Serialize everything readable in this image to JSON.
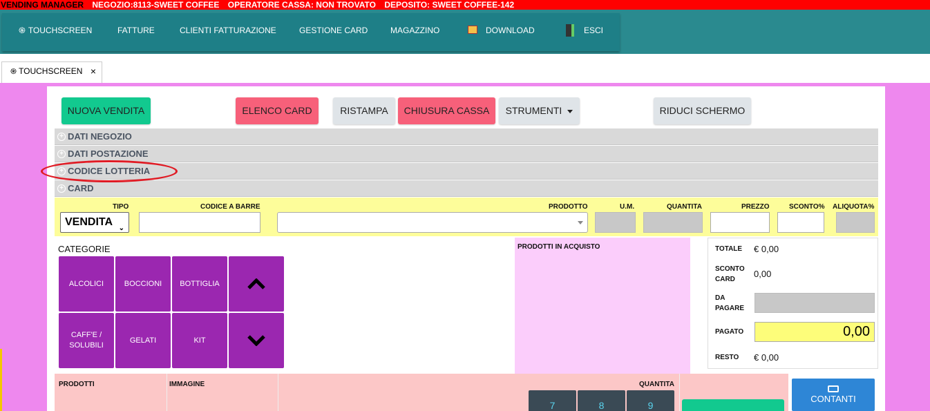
{
  "topbar": {
    "app": "VENDING MANAGER",
    "negozio": "NEGOZIO:8113-SWEET COFFEE",
    "operatore": "OPERATORE CASSA: NON TROVATO",
    "deposito": "DEPOSITO: SWEET COFFEE-142"
  },
  "nav": {
    "touchscreen": "TOUCHSCREEN",
    "fatture": "FATTURE",
    "clienti": "CLIENTI FATTURAZIONE",
    "card": "GESTIONE CARD",
    "magazzino": "MAGAZZINO",
    "download": "DOWNLOAD",
    "esci": "ESCI"
  },
  "tab": {
    "label": "TOUCHSCREEN",
    "close": "×"
  },
  "toolbar": {
    "nuova_vendita": "NUOVA VENDITA",
    "elenco_card": "ELENCO CARD",
    "ristampa": "RISTAMPA",
    "chiusura_cassa": "CHIUSURA CASSA",
    "strumenti": "STRUMENTI",
    "riduci_schermo": "RIDUCI SCHERMO"
  },
  "accordion": [
    "DATI NEGOZIO",
    "DATI POSTAZIONE",
    "CODICE LOTTERIA",
    "CARD"
  ],
  "entry": {
    "tipo_label": "TIPO",
    "tipo_value": "VENDITA",
    "codice_label": "CODICE A BARRE",
    "prodotto_label": "PRODOTTO",
    "um_label": "U.M.",
    "quantita_label": "QUANTITA",
    "prezzo_label": "PREZZO",
    "sconto_label": "SCONTO%",
    "aliquota_label": "ALIQUOTA%"
  },
  "categories": {
    "title": "CATEGORIE",
    "items": [
      "ALCOLICI",
      "BOCCIONI",
      "BOTTIGLIA",
      "CAFF'E / SOLUBILI",
      "GELATI",
      "KIT"
    ]
  },
  "purchase": {
    "title": "PRODOTTI IN ACQUISTO"
  },
  "totals": {
    "totale_label": "TOTALE",
    "totale_value": "€ 0,00",
    "sconto_label": "SCONTO CARD",
    "sconto_value": "0,00",
    "da_pagare_label": "DA PAGARE",
    "pagato_label": "PAGATO",
    "pagato_value": "0,00",
    "resto_label": "RESTO",
    "resto_value": "€ 0,00"
  },
  "bottom": {
    "prodotti": "PRODOTTI",
    "immagine": "IMMAGINE",
    "quantita": "QUANTITA",
    "keys": [
      "7",
      "8",
      "9"
    ],
    "contanti": "CONTANTI"
  },
  "colors": {
    "topbar": "#ff0000",
    "nav": "#1e7f87",
    "canvas": "#ee88ee",
    "category": "#9b27b0",
    "green": "#12c98f",
    "red": "#f7607a"
  }
}
